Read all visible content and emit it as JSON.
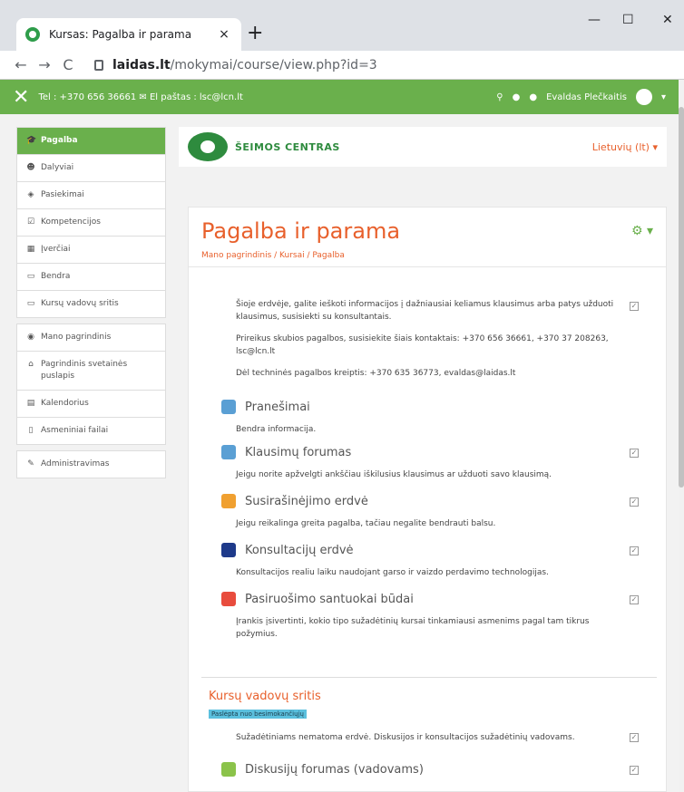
{
  "browser": {
    "tab_title": "Kursas: Pagalba ir parama",
    "tab_close": "×",
    "new_tab": "+",
    "url_host": "laidas.lt",
    "url_path": "/mokymai/course/view.php?id=3",
    "minimize": "—",
    "maximize": "☐",
    "close": "✕"
  },
  "navbar": {
    "contact": "Tel : +370 656 36661 ✉ El paštas : lsc@lcn.lt",
    "user": "Evaldas Plečkaitis"
  },
  "sidebar": {
    "items": [
      {
        "label": "Pagalba",
        "icon": "graduation-cap-icon",
        "active": true
      },
      {
        "label": "Dalyviai",
        "icon": "users-icon"
      },
      {
        "label": "Pasiekimai",
        "icon": "shield-icon"
      },
      {
        "label": "Kompetencijos",
        "icon": "checkbox-icon"
      },
      {
        "label": "Įverčiai",
        "icon": "table-icon"
      },
      {
        "label": "Bendra",
        "icon": "folder-icon"
      },
      {
        "label": "Kursų vadovų sritis",
        "icon": "folder-icon"
      }
    ],
    "items2": [
      {
        "label": "Mano pagrindinis",
        "icon": "dashboard-icon"
      },
      {
        "label": "Pagrindinis svetainės puslapis",
        "icon": "home-icon"
      },
      {
        "label": "Kalendorius",
        "icon": "calendar-icon"
      },
      {
        "label": "Asmeniniai failai",
        "icon": "file-icon"
      }
    ],
    "items3": [
      {
        "label": "Administravimas",
        "icon": "wrench-icon"
      }
    ]
  },
  "header": {
    "brand": "ŠEIMOS CENTRAS",
    "language": "Lietuvių (lt) ▾"
  },
  "course": {
    "title": "Pagalba ir parama",
    "breadcrumb": "Mano pagrindinis / Kursai / Pagalba"
  },
  "content": {
    "intro": "Šioje erdvėje, galite ieškoti informacijos į dažniausiai keliamus klausimus arba patys užduoti klausimus, susisiekti su konsultantais.",
    "urgent": "Prireikus skubios pagalbos, susisiekite šiais kontaktais: +370 656 36661, +370 37 208263, lsc@lcn.lt",
    "tech": "Dėl techninės pagalbos kreiptis: +370 635 36773, evaldas@laidas.lt",
    "activities": [
      {
        "name": "Pranešimai",
        "desc": "Bendra informacija.",
        "color": "#5a9fd4"
      },
      {
        "name": "Klausimų forumas",
        "desc": "Jeigu norite apžvelgti ankščiau iškilusius klausimus ar užduoti savo klausimą.",
        "color": "#5a9fd4"
      },
      {
        "name": "Susirašinėjimo erdvė",
        "desc": "Jeigu reikalinga greita pagalba, tačiau negalite bendrauti balsu.",
        "color": "#f0a030"
      },
      {
        "name": "Konsultacijų erdvė",
        "desc": "Konsultacijos realiu laiku naudojant garso ir vaizdo perdavimo technologijas.",
        "color": "#1e3a8a"
      },
      {
        "name": "Pasiruošimo santuokai būdai",
        "desc": "Įrankis įsivertinti, kokio tipo sužadėtinių kursai tinkamiausi asmenims pagal tam tikrus požymius.",
        "color": "#e84c3d"
      }
    ],
    "section2_title": "Kursų vadovų sritis",
    "hidden_label": "Paslėpta nuo besimokančiųjų",
    "section2_desc": "Sužadėtiniams nematoma erdvė. Diskusijos ir konsultacijos sužadėtinių vadovams.",
    "forum2": "Diskusijų forumas (vadovams)"
  }
}
